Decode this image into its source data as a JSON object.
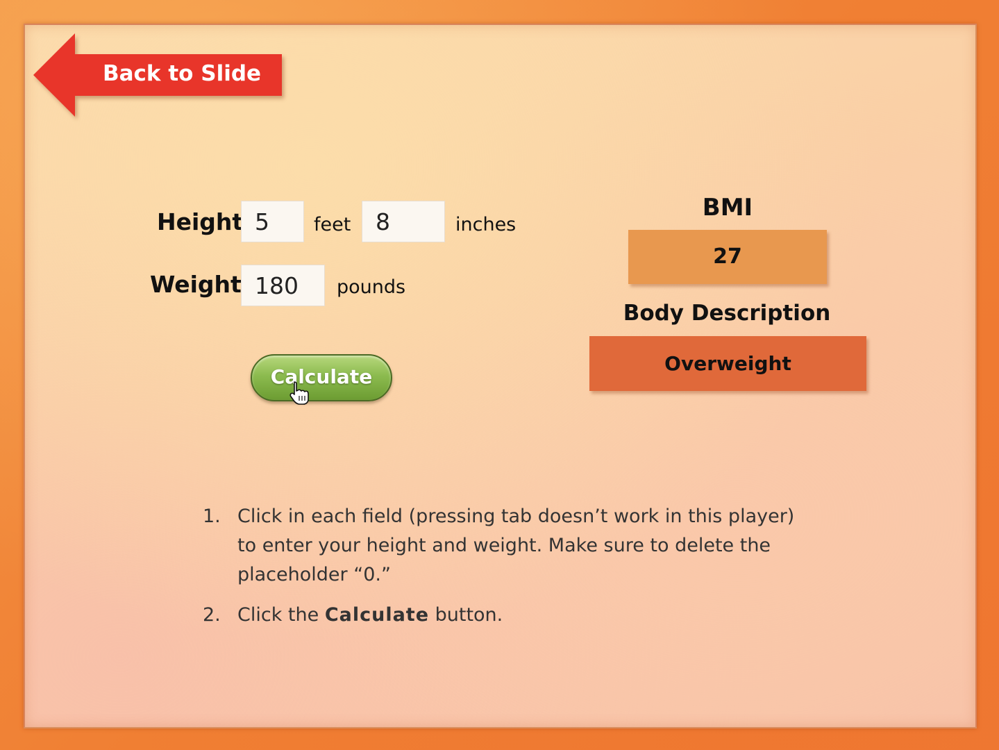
{
  "back_button": {
    "label": "Back to Slide"
  },
  "form": {
    "height_label": "Height",
    "height_feet_value": "5",
    "feet_unit": "feet",
    "height_inches_value": "8",
    "inches_unit": "inches",
    "weight_label": "Weight",
    "weight_value": "180",
    "pounds_unit": "pounds",
    "calculate_label": "Calculate"
  },
  "results": {
    "bmi_heading": "BMI",
    "bmi_value": "27",
    "description_heading": "Body Description",
    "description_value": "Overweight"
  },
  "instructions": [
    {
      "number": "1.",
      "text": "Click in each field (pressing tab doesn’t work in this player) to enter your height and weight. Make sure to delete the placeholder “0.”"
    },
    {
      "number": "2.",
      "text_before": "Click the ",
      "text_bold": "Calculate",
      "text_after": " button."
    }
  ],
  "colors": {
    "frame": "#f0803a",
    "back_arrow": "#e8352a",
    "bmi_box": "#e8984f",
    "description_box": "#e0693a",
    "calculate_button": "#8cbb4f"
  },
  "icons": {
    "back_arrow": "arrow-left-icon",
    "cursor": "hand-pointer-icon"
  }
}
